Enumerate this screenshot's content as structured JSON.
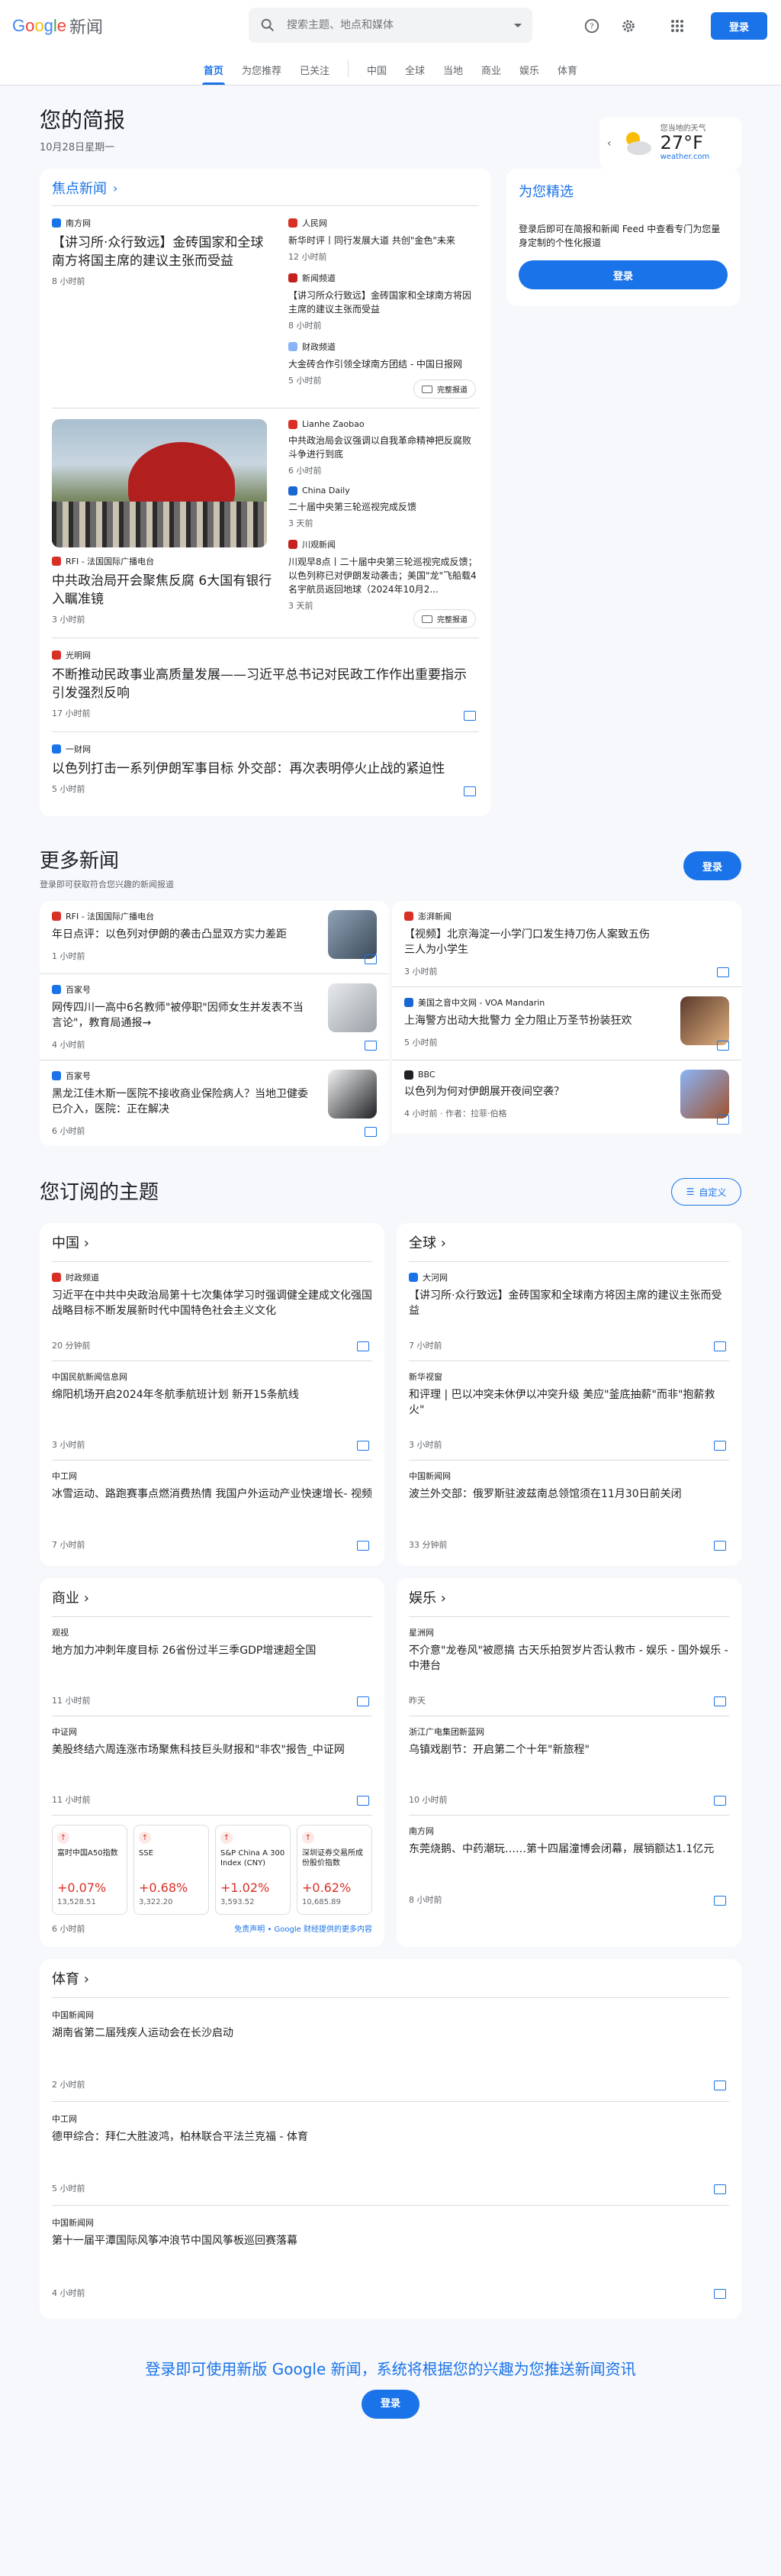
{
  "header": {
    "logo": {
      "g": "G",
      "o1": "o",
      "o2": "o",
      "g2": "g",
      "l": "l",
      "e": "e",
      "news": "新闻"
    },
    "search_placeholder": "搜索主题、地点和媒体",
    "login": "登录"
  },
  "nav": [
    "首页",
    "为您推荐",
    "已关注",
    "中国",
    "全球",
    "当地",
    "商业",
    "娱乐",
    "体育"
  ],
  "brief": {
    "title": "您的简报",
    "date": "10月28日星期一"
  },
  "weather": {
    "label": "您当地的天气",
    "temp": "27°F",
    "source": "weather.com"
  },
  "headlines": {
    "title": "焦点新闻",
    "full_coverage": "完整报道",
    "clusters": [
      {
        "main": {
          "source": "南方网",
          "title": "【讲习所·众行致远】金砖国家和全球南方将国主席的建议主张而受益",
          "time": "8 小时前"
        },
        "subs": [
          {
            "source": "人民网",
            "title": "新华时评丨同行发展大道 共创\"金色\"未来",
            "time": "12 小时前"
          },
          {
            "source": "新闻频道",
            "title": "【讲习所众行致远】金砖国家和全球南方将因主席的建议主张而受益",
            "time": "8 小时前"
          },
          {
            "source": "财政频道",
            "title": "大金砖合作引领全球南方团结 - 中国日报网",
            "time": "5 小时前"
          }
        ]
      },
      {
        "main": {
          "source": "RFI - 法国国际广播电台",
          "title": "中共政治局开会聚焦反腐 6大国有银行入瞩准镜",
          "time": "3 小时前"
        },
        "subs": [
          {
            "source": "Lianhe Zaobao",
            "title": "中共政治局会议强调以自我革命精神把反腐败斗争进行到底",
            "time": "6 小时前"
          },
          {
            "source": "China Daily",
            "title": "二十届中央第三轮巡视完成反馈",
            "time": "3 天前"
          },
          {
            "source": "川观新闻",
            "title": "川观早8点丨二十届中央第三轮巡视完成反馈；以色列称已对伊朗发动袭击；美国\"龙\"飞船载4名宇航员返回地球（2024年10月2...",
            "time": "3 天前"
          }
        ]
      }
    ],
    "singles": [
      {
        "source": "光明网",
        "title": "不断推动民政事业高质量发展——习近平总书记对民政工作作出重要指示引发强烈反响",
        "time": "17 小时前"
      },
      {
        "source": "一财网",
        "title": "以色列打击一系列伊朗军事目标 外交部：再次表明停火止战的紧迫性",
        "time": "5 小时前"
      }
    ]
  },
  "foryou": {
    "title": "为您精选",
    "text": "登录后即可在简报和新闻 Feed 中查看专门为您量身定制的个性化报道",
    "button": "登录"
  },
  "more_news": {
    "title": "更多新闻",
    "desc": "登录即可获取符合您兴趣的新闻报道",
    "button": "登录",
    "left": [
      {
        "source": "RFI - 法国国际广播电台",
        "title": "年日点评：以色列对伊朗的袭击凸显双方实力差距",
        "time": "1 小时前"
      },
      {
        "source": "百家号",
        "title": "网传四川一高中6名教师\"被停职\"因师女生并发表不当言论\"，教育局通报→",
        "time": "4 小时前"
      },
      {
        "source": "百家号",
        "title": "黑龙江佳木斯一医院不接收商业保险病人？当地卫健委已介入，医院：正在解决",
        "time": "6 小时前"
      }
    ],
    "right": [
      {
        "source": "澎湃新闻",
        "title": "【视频】北京海淀一小学门口发生持刀伤人案致五伤 三人为小学生",
        "time": "3 小时前"
      },
      {
        "source": "美国之音中文网 - VOA Mandarin",
        "title": "上海警方出动大批警力 全力阻止万圣节扮装狂欢",
        "time": "5 小时前"
      },
      {
        "source": "BBC",
        "title": "以色列为何对伊朗展开夜间空袭？",
        "time": "4 小时前 · 作者：拉菲·伯格"
      }
    ]
  },
  "topics": {
    "title": "您订阅的主题",
    "customize": "自定义",
    "china": {
      "title": "中国",
      "items": [
        {
          "source": "时政频道",
          "title": "习近平在中共中央政治局第十七次集体学习时强调健全建成文化强国战略目标不断发展新时代中国特色社会主义文化",
          "time": "20 分钟前"
        },
        {
          "source": "中国民航新闻信息网",
          "title": "绵阳机场开启2024年冬航季航班计划 新开15条航线",
          "time": "3 小时前"
        },
        {
          "source": "中工网",
          "title": "冰雪运动、路跑赛事点燃消费热情 我国户外运动产业快速增长- 视频",
          "time": "7 小时前"
        }
      ]
    },
    "world": {
      "title": "全球",
      "items": [
        {
          "source": "大河网",
          "title": "【讲习所·众行致远】金砖国家和全球南方将因主席的建议主张而受益",
          "time": "7 小时前"
        },
        {
          "source": "新华视窗",
          "title": "和评理 | 巴以冲突未休伊以冲突升级 美应\"釜底抽薪\"而非\"抱薪救火\"",
          "time": "3 小时前"
        },
        {
          "source": "中国新闻网",
          "title": "波兰外交部：俄罗斯驻波兹南总领馆须在11月30日前关闭",
          "time": "33 分钟前"
        }
      ]
    },
    "business": {
      "title": "商业",
      "items": [
        {
          "source": "观视",
          "title": "地方加力冲刺年度目标 26省份过半三季GDP增速超全国",
          "time": "11 小时前"
        },
        {
          "source": "中证网",
          "title": "美股终结六周连涨市场聚焦科技巨头财报和\"非农\"报告_中证网",
          "time": "11 小时前"
        }
      ],
      "stocks": [
        {
          "name": "富时中国A50指数",
          "pct": "+0.07%",
          "val": "13,528.51"
        },
        {
          "name": "SSE",
          "pct": "+0.68%",
          "val": "3,322.20"
        },
        {
          "name": "S&P China A 300 Index (CNY)",
          "pct": "+1.02%",
          "val": "3,593.52"
        },
        {
          "name": "深圳证券交易所成份股价指数",
          "pct": "+0.62%",
          "val": "10,685.89"
        }
      ],
      "stock_time": "6 小时前",
      "disclaimer": "免责声明 • Google 财经提供的更多内容"
    },
    "ent": {
      "title": "娱乐",
      "items": [
        {
          "source": "星洲网",
          "title": "不介意\"龙卷风\"被愿搞 古天乐拍贺岁片否认救市 - 娱乐 - 国外娱乐 - 中港台",
          "time": "昨天"
        },
        {
          "source": "浙江广电集团新蓝网",
          "title": "乌镇戏剧节：开启第二个十年\"新旅程\"",
          "time": "10 小时前"
        },
        {
          "source": "南方网",
          "title": "东莞烧鹅、中药潮玩……第十四届潼博会闭幕，展销额达1.1亿元",
          "time": "8 小时前"
        }
      ]
    },
    "sports": {
      "title": "体育",
      "items": [
        {
          "source": "中国新闻网",
          "title": "湖南省第二届残疾人运动会在长沙启动",
          "time": "2 小时前"
        },
        {
          "source": "中工网",
          "title": "德甲综合：拜仁大胜波鸿，柏林联合平法兰克福 - 体育",
          "time": "5 小时前"
        },
        {
          "source": "中国新闻网",
          "title": "第十一届平潭国际风筝冲浪节中国风筝板巡回赛落幕",
          "time": "4 小时前"
        }
      ]
    }
  },
  "footer": {
    "text": "登录即可使用新版 Google 新闻，系统将根据您的兴趣为您推送新闻资讯",
    "button": "登录"
  }
}
